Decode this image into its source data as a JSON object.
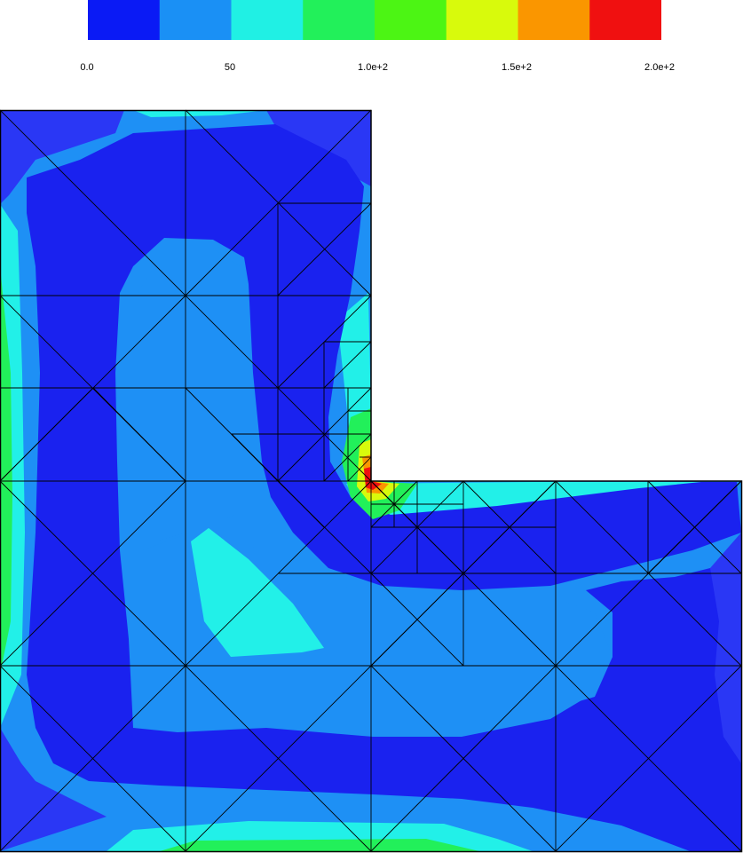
{
  "legend": {
    "colors": [
      "#0a1af5",
      "#1a90f5",
      "#20f0e4",
      "#22f05a",
      "#4cf514",
      "#d8fa0c",
      "#fa9600",
      "#f01010"
    ],
    "tick_labels": [
      "0.0",
      "50",
      "1.0e+2",
      "1.5e+2",
      "2.0e+2"
    ],
    "range": [
      0,
      200
    ]
  },
  "plot": {
    "palette": {
      "deep_blue": "#1720f0",
      "blue": "#2a37f5",
      "light_blue": "#1e90f5",
      "cyan": "#22f0e8",
      "green": "#22f05a",
      "yellow": "#d8fa0c",
      "orange": "#fa9600",
      "red": "#f01010",
      "mesh": "#000000"
    }
  }
}
